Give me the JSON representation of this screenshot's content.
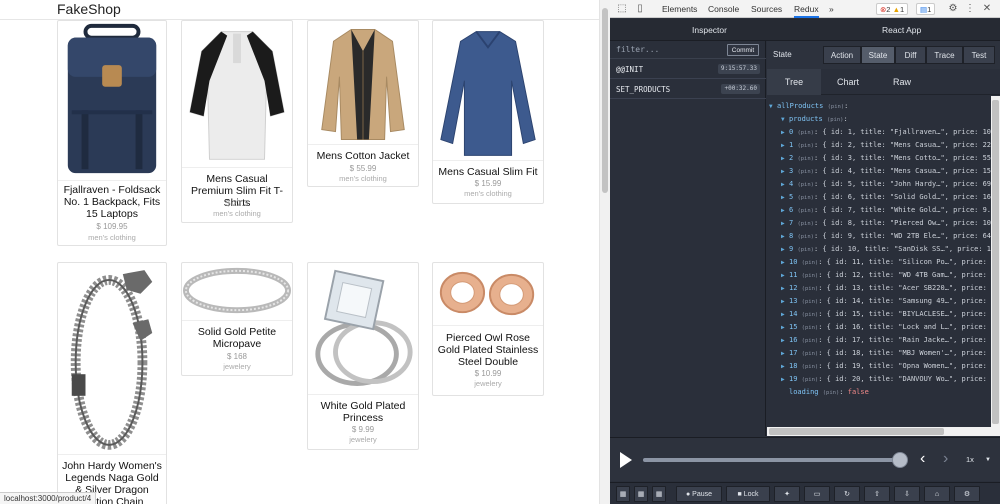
{
  "shop": {
    "title": "FakeShop",
    "status_url": "localhost:3000/product/4",
    "products": [
      {
        "title": "Fjallraven - Foldsack No. 1 Backpack, Fits 15 Laptops",
        "price": "$ 109.95",
        "category": "men's clothing",
        "icon": "backpack-image"
      },
      {
        "title": "Mens Casual Premium Slim Fit T-Shirts",
        "price": "$ 22.3",
        "category": "men's clothing",
        "icon": "tshirt-image"
      },
      {
        "title": "Mens Cotton Jacket",
        "price": "$ 55.99",
        "category": "men's clothing",
        "icon": "jacket-image"
      },
      {
        "title": "Mens Casual Slim Fit",
        "price": "$ 15.99",
        "category": "men's clothing",
        "icon": "longsleeve-image"
      },
      {
        "title": "John Hardy Women's Legends Naga Gold & Silver Dragon Station Chain Bracelet",
        "price": "",
        "category": "",
        "icon": "bracelet-image"
      },
      {
        "title": "Solid Gold Petite Micropave",
        "price": "$ 168",
        "category": "jewelery",
        "icon": "ring-band-image"
      },
      {
        "title": "White Gold Plated Princess",
        "price": "$ 9.99",
        "category": "jewelery",
        "icon": "diamond-ring-image"
      },
      {
        "title": "Pierced Owl Rose Gold Plated Stainless Steel Double",
        "price": "$ 10.99",
        "category": "jewelery",
        "icon": "plug-earrings-image"
      }
    ]
  },
  "devtools": {
    "tabs": [
      "Elements",
      "Console",
      "Sources",
      "Redux",
      "»"
    ],
    "selected_tab": "Redux",
    "badges": {
      "errors": "2",
      "warnings": "1",
      "messages": "1"
    },
    "accent": "#1a73e8"
  },
  "redux": {
    "inspector_label": "Inspector",
    "app_label": "React App",
    "filter_placeholder": "filter...",
    "commit_label": "Commit",
    "actions": [
      {
        "name": "@@INIT",
        "time": "9:15:57.33"
      },
      {
        "name": "SET_PRODUCTS",
        "time": "+00:32.60"
      }
    ],
    "state_label": "State",
    "monitor_buttons": [
      "Action",
      "State",
      "Diff",
      "Trace",
      "Test"
    ],
    "selected_monitor": "State",
    "view_tabs": [
      "Tree",
      "Chart",
      "Raw"
    ],
    "selected_view": "Tree",
    "tree": {
      "root_key": "allProducts",
      "products_key": "products",
      "pin": "(pin)",
      "items": [
        {
          "k": "0",
          "v": "{ id: 1, title: \"Fjallraven…\", price: 10"
        },
        {
          "k": "1",
          "v": "{ id: 2, title: \"Mens Casua…\", price: 22"
        },
        {
          "k": "2",
          "v": "{ id: 3, title: \"Mens Cotto…\", price: 55"
        },
        {
          "k": "3",
          "v": "{ id: 4, title: \"Mens Casua…\", price: 15"
        },
        {
          "k": "4",
          "v": "{ id: 5, title: \"John Hardy…\", price: 69"
        },
        {
          "k": "5",
          "v": "{ id: 6, title: \"Solid Gold…\", price: 16"
        },
        {
          "k": "6",
          "v": "{ id: 7, title: \"White Gold…\", price: 9."
        },
        {
          "k": "7",
          "v": "{ id: 8, title: \"Pierced Ow…\", price: 10"
        },
        {
          "k": "8",
          "v": "{ id: 9, title: \"WD 2TB Ele…\", price: 64"
        },
        {
          "k": "9",
          "v": "{ id: 10, title: \"SanDisk SS…\", price: 1"
        },
        {
          "k": "10",
          "v": "{ id: 11, title: \"Silicon Po…\", price:"
        },
        {
          "k": "11",
          "v": "{ id: 12, title: \"WD 4TB Gam…\", price:"
        },
        {
          "k": "12",
          "v": "{ id: 13, title: \"Acer SB220…\", price:"
        },
        {
          "k": "13",
          "v": "{ id: 14, title: \"Samsung 49…\", price:"
        },
        {
          "k": "14",
          "v": "{ id: 15, title: \"BIYLACLESE…\", price:"
        },
        {
          "k": "15",
          "v": "{ id: 16, title: \"Lock and L…\", price:"
        },
        {
          "k": "16",
          "v": "{ id: 17, title: \"Rain Jacke…\", price:"
        },
        {
          "k": "17",
          "v": "{ id: 18, title: \"MBJ Women'…\", price:"
        },
        {
          "k": "18",
          "v": "{ id: 19, title: \"Opna Women…\", price:"
        },
        {
          "k": "19",
          "v": "{ id: 20, title: \"DANVOUY Wo…\", price:"
        }
      ],
      "loading_key": "loading",
      "loading_value": "false"
    },
    "speed": "1x",
    "bottom_buttons": [
      "Pause",
      "Lock"
    ]
  }
}
